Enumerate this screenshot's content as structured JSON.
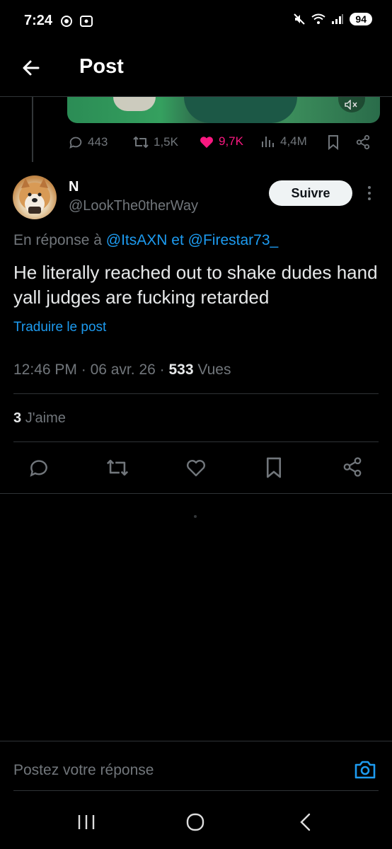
{
  "status_bar": {
    "time": "7:24",
    "battery": "94"
  },
  "header": {
    "title": "Post"
  },
  "quoted_stats": {
    "replies": "443",
    "reposts": "1,5K",
    "likes": "9,7K",
    "views": "4,4M"
  },
  "post": {
    "author_name": "N",
    "author_handle": "@LookThe0therWay",
    "follow_label": "Suivre",
    "reply_prefix": "En réponse à",
    "reply_mention_1": "@ItsAXN",
    "reply_joiner": "et",
    "reply_mention_2": "@Firestar73_",
    "text": "He literally reached out to shake dudes hand yall judges are fucking retarded",
    "translate_label": "Traduire le post",
    "time": "12:46 PM",
    "date": "06 avr. 26",
    "views_count": "533",
    "views_label": "Vues",
    "likes_count": "3",
    "likes_label": "J'aime"
  },
  "composer": {
    "placeholder": "Postez votre réponse"
  },
  "colors": {
    "accent": "#1d9bf0",
    "like": "#f91880",
    "muted": "#71767b",
    "text": "#e7e9ea"
  }
}
